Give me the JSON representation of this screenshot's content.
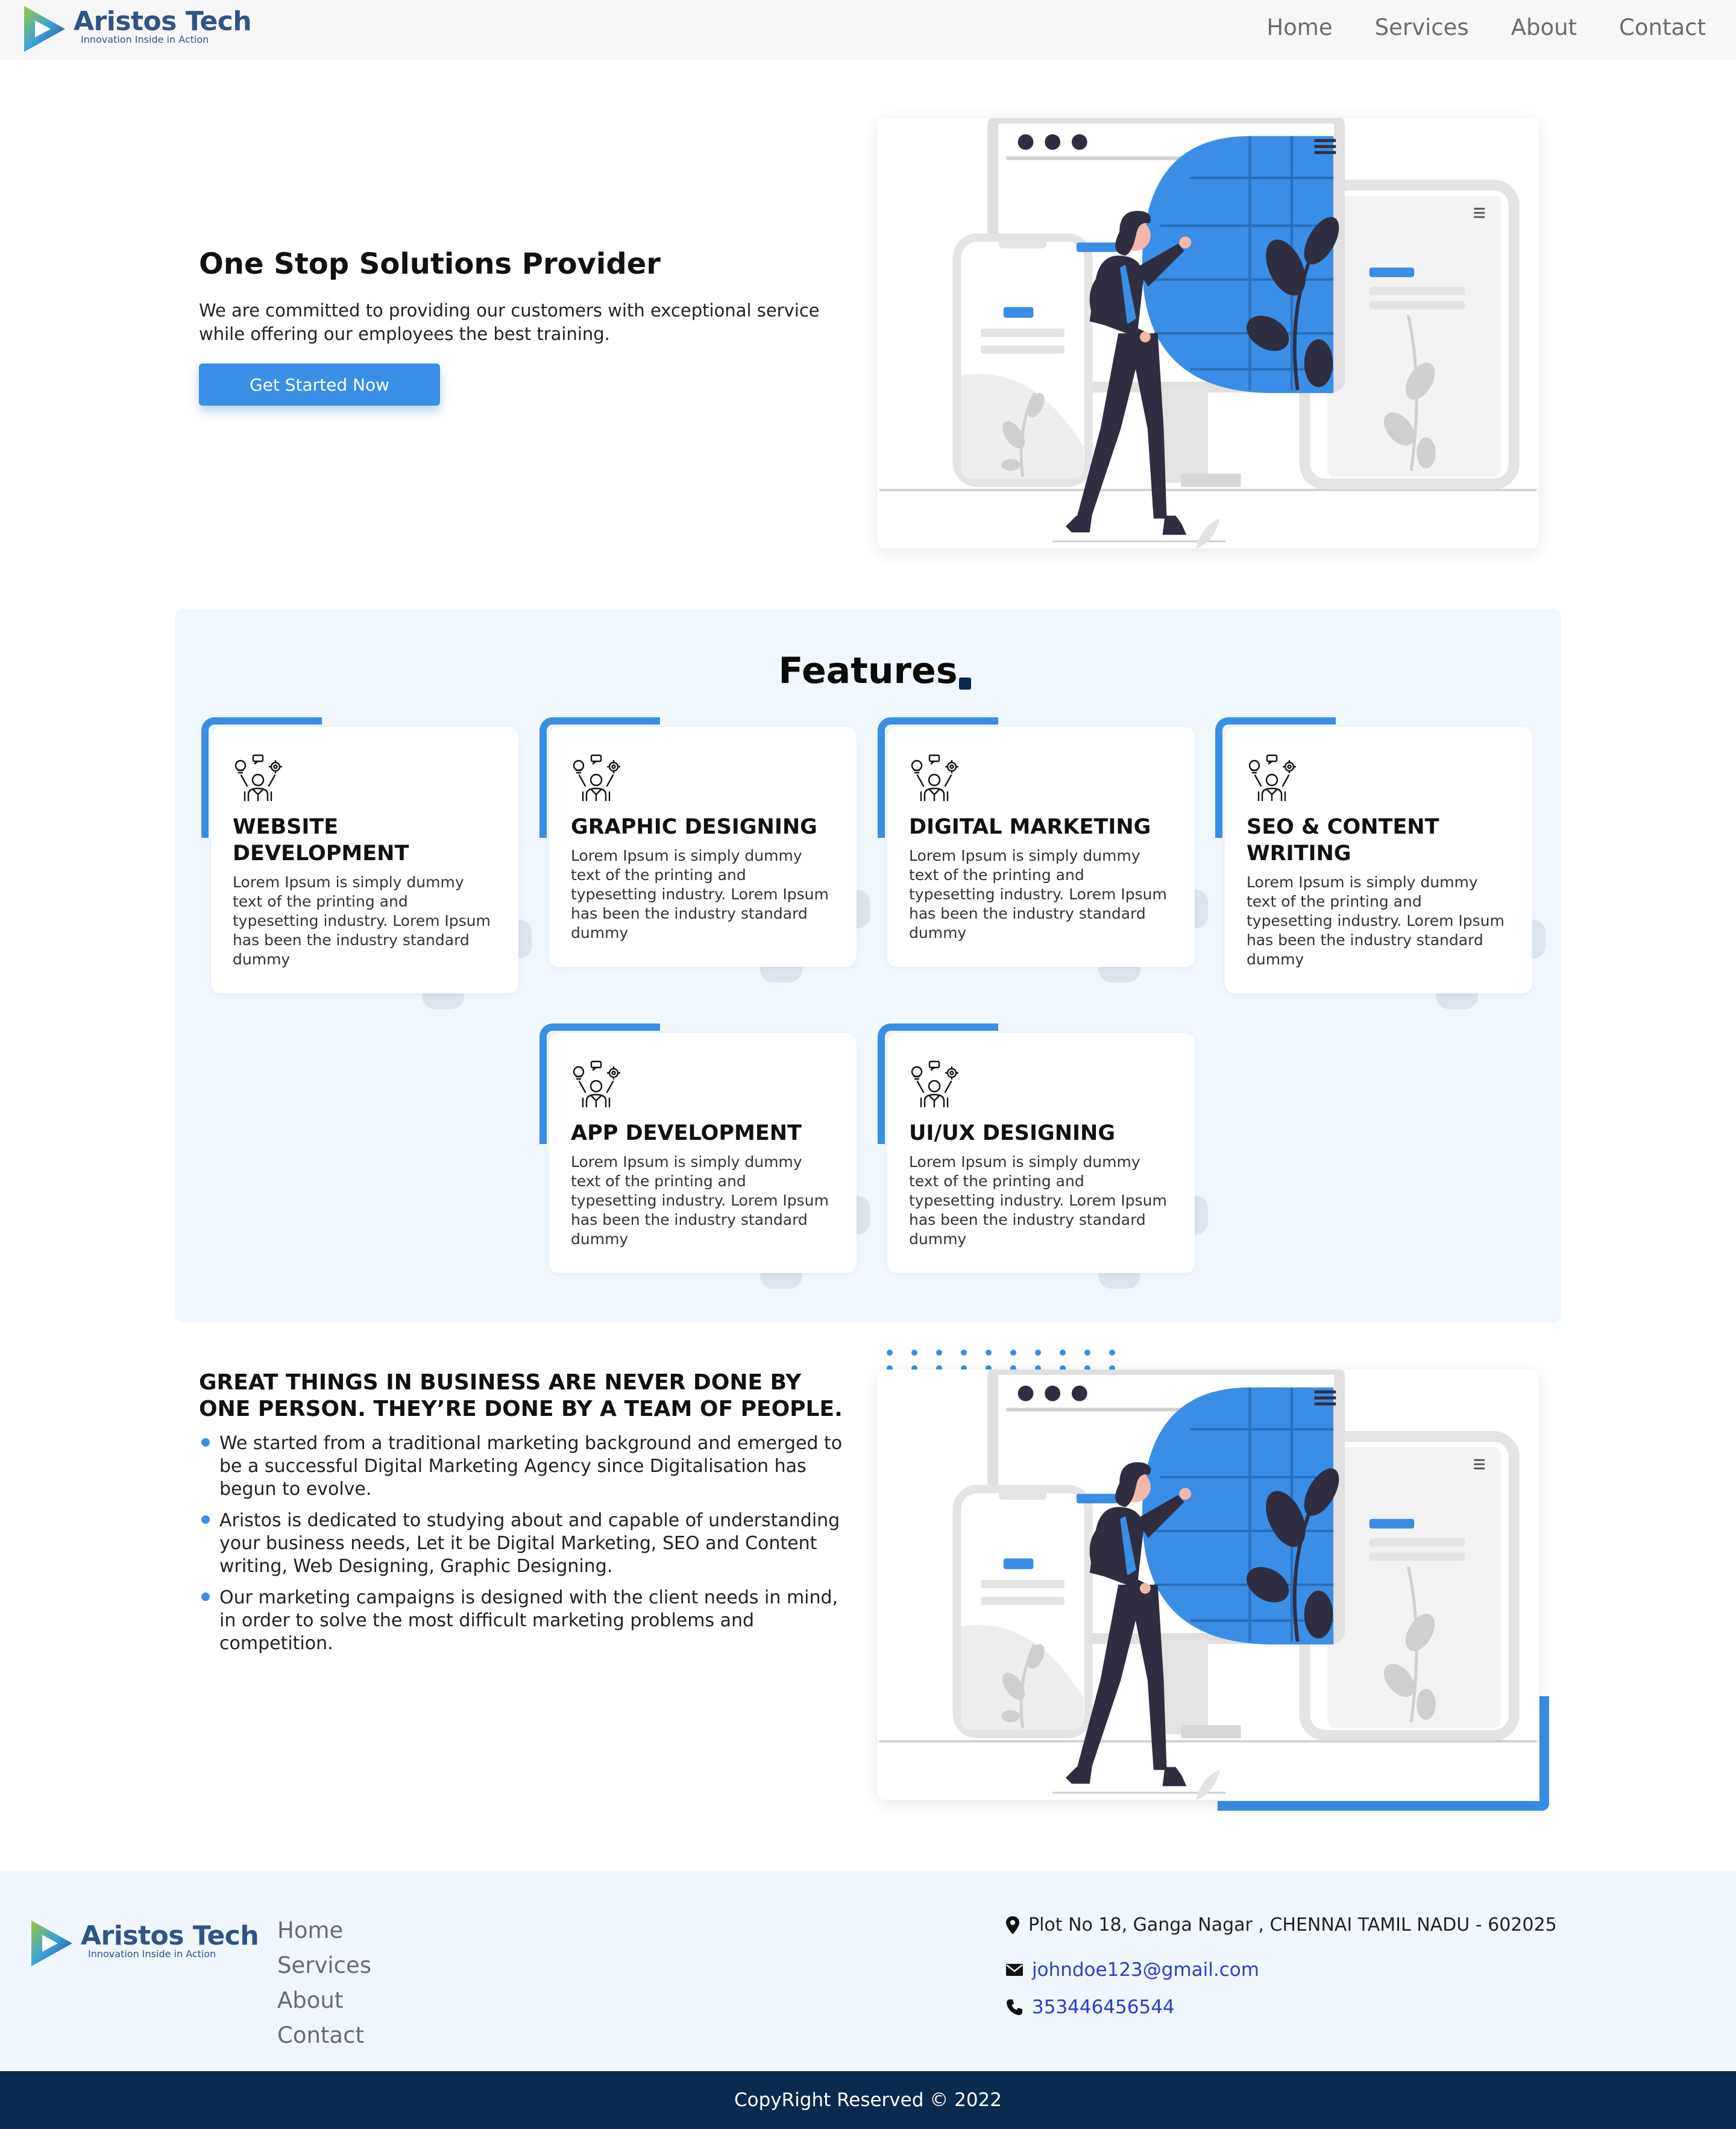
{
  "brand": {
    "name": "Aristos Tech",
    "tagline": "Innovation Inside in Action"
  },
  "nav": {
    "items": [
      {
        "label": "Home"
      },
      {
        "label": "Services"
      },
      {
        "label": "About"
      },
      {
        "label": "Contact"
      }
    ]
  },
  "hero": {
    "title": "One Stop Solutions Provider",
    "description": "We are committed to providing our customers with exceptional service while offering our employees the best training.",
    "cta_label": "Get Started Now"
  },
  "features": {
    "title": "Features",
    "cards": [
      {
        "title": "WEBSITE DEVELOPMENT",
        "text": "Lorem Ipsum is simply dummy text of the printing and typesetting industry. Lorem Ipsum has been the industry standard dummy",
        "icon": "team-ideas-icon"
      },
      {
        "title": "GRAPHIC DESIGNING",
        "text": "Lorem Ipsum is simply dummy text of the printing and typesetting industry. Lorem Ipsum has been the industry standard dummy",
        "icon": "team-ideas-icon"
      },
      {
        "title": "DIGITAL MARKETING",
        "text": "Lorem Ipsum is simply dummy text of the printing and typesetting industry. Lorem Ipsum has been the industry standard dummy",
        "icon": "team-ideas-icon"
      },
      {
        "title": "SEO & CONTENT WRITING",
        "text": "Lorem Ipsum is simply dummy text of the printing and typesetting industry. Lorem Ipsum has been the industry standard dummy",
        "icon": "team-ideas-icon"
      },
      {
        "title": "APP DEVELOPMENT",
        "text": "Lorem Ipsum is simply dummy text of the printing and typesetting industry. Lorem Ipsum has been the industry standard dummy",
        "icon": "team-ideas-icon"
      },
      {
        "title": "UI/UX DESIGNING",
        "text": "Lorem Ipsum is simply dummy text of the printing and typesetting industry. Lorem Ipsum has been the industry standard dummy",
        "icon": "team-ideas-icon"
      }
    ]
  },
  "team": {
    "title": "GREAT THINGS IN BUSINESS ARE NEVER DONE BY ONE PERSON. THEY’RE DONE BY A TEAM OF PEOPLE.",
    "points": [
      "We started from a traditional marketing background and emerged to be a successful Digital Marketing Agency since Digitalisation has begun to evolve.",
      "Aristos is dedicated to studying about and capable of understanding your business needs, Let it be Digital Marketing, SEO and Content writing, Web Designing, Graphic Designing.",
      "Our marketing campaigns is designed with the client needs in mind, in order to solve the most difficult marketing problems and competition."
    ]
  },
  "footer": {
    "links": [
      {
        "label": "Home"
      },
      {
        "label": "Services"
      },
      {
        "label": "About"
      },
      {
        "label": "Contact"
      }
    ],
    "address": "Plot No 18, Ganga Nagar , CHENNAI TAMIL NADU - 602025",
    "email": "johndoe123@gmail.com",
    "phone": "353446456544",
    "copyright": "CopyRight Reserved © 2022"
  },
  "colors": {
    "accent": "#3a8ee6",
    "brand_text": "#2f5486",
    "footer_bar": "#0b2a4f",
    "features_bg": "#f1f7fe",
    "link": "#2a3ec9"
  },
  "icons": [
    "play-logo-icon",
    "team-ideas-icon",
    "location-pin-icon",
    "envelope-icon",
    "phone-icon"
  ]
}
